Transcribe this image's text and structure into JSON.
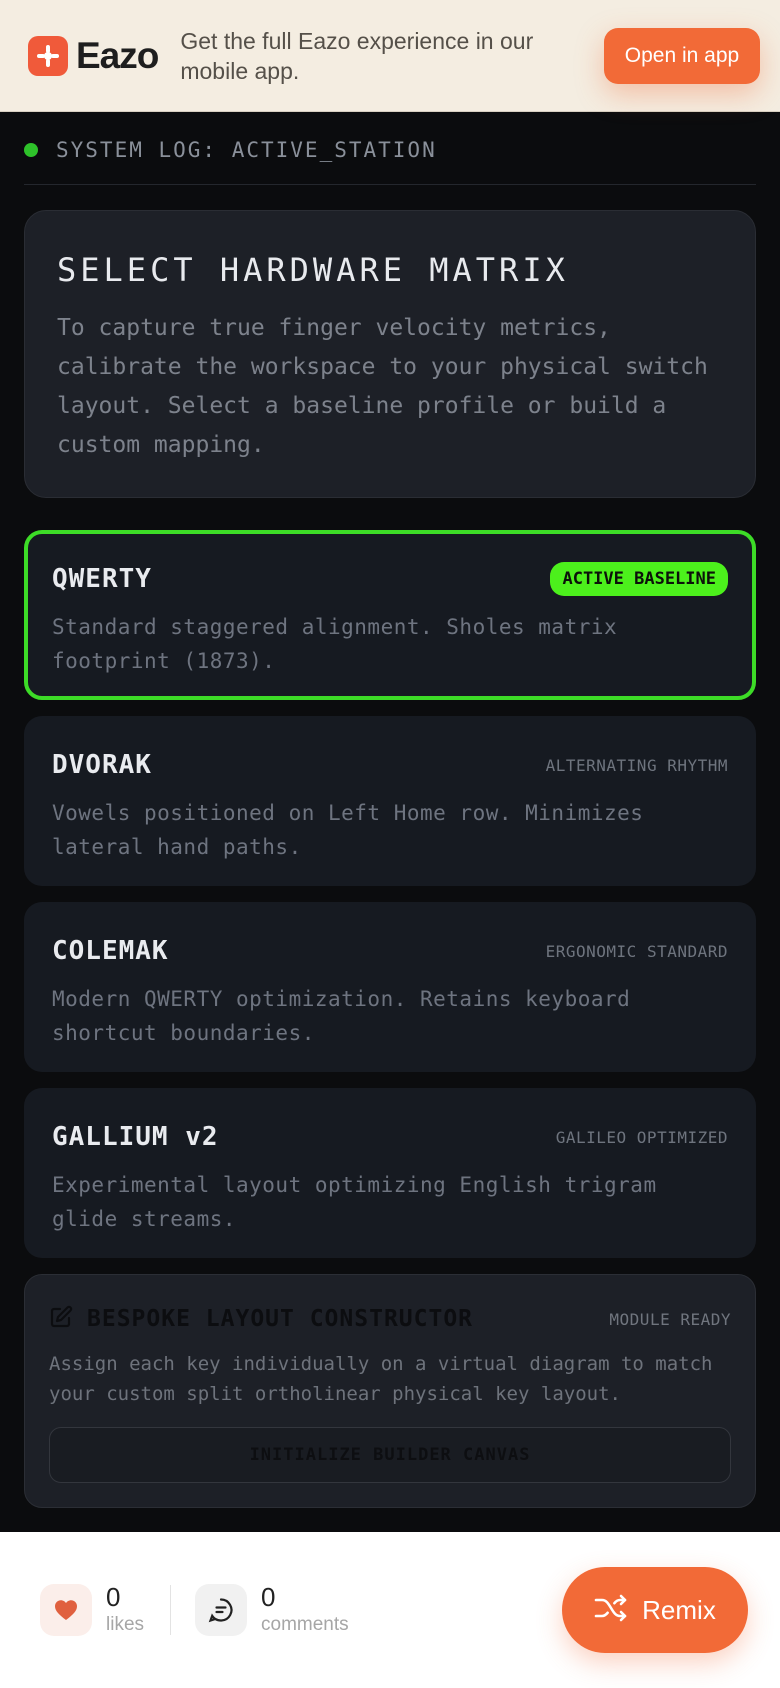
{
  "banner": {
    "brand": "Eazo",
    "message": "Get the full Eazo experience in our mobile app.",
    "open_label": "Open in app"
  },
  "system_log": {
    "text": "SYSTEM LOG: ACTIVE_STATION",
    "status_color": "#2ec22a"
  },
  "intro": {
    "title": "SELECT HARDWARE MATRIX",
    "description": "To capture true finger velocity metrics, calibrate the workspace to your physical switch layout. Select a baseline profile or build a custom mapping."
  },
  "layouts": [
    {
      "name": "QWERTY",
      "tag": "ACTIVE BASELINE",
      "active": true,
      "description": "Standard staggered alignment. Sholes matrix footprint (1873)."
    },
    {
      "name": "DVORAK",
      "tag": "ALTERNATING RHYTHM",
      "active": false,
      "description": "Vowels positioned on Left Home row. Minimizes lateral hand paths."
    },
    {
      "name": "COLEMAK",
      "tag": "ERGONOMIC STANDARD",
      "active": false,
      "description": "Modern QWERTY optimization. Retains keyboard shortcut boundaries."
    },
    {
      "name": "GALLIUM v2",
      "tag": "GALILEO OPTIMIZED",
      "active": false,
      "description": "Experimental layout optimizing English trigram glide streams."
    }
  ],
  "bespoke": {
    "title": "BESPOKE LAYOUT CONSTRUCTOR",
    "status": "MODULE READY",
    "description": "Assign each key individually on a virtual diagram to match your custom split ortholinear physical key layout.",
    "button_label": "INITIALIZE BUILDER CANVAS"
  },
  "footer": {
    "likes_count": "0",
    "likes_label": "likes",
    "comments_count": "0",
    "comments_label": "comments",
    "remix_label": "Remix"
  },
  "colors": {
    "accent": "#f26a37",
    "active_green": "#3ddc27",
    "badge_green": "#4cf01c"
  }
}
